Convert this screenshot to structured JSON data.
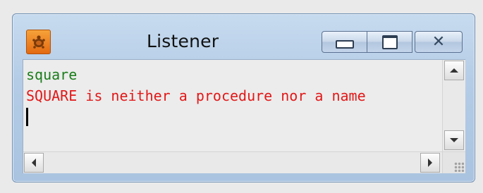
{
  "window": {
    "title": "Listener",
    "icon": "turtle-logo-icon",
    "controls": {
      "minimize": "minimize-icon",
      "maximize": "maximize-icon",
      "close": "close-icon"
    }
  },
  "listener": {
    "lines": [
      {
        "text": "square",
        "kind": "command",
        "color": "#1a7d1a"
      },
      {
        "text": "SQUARE is neither a procedure nor a name",
        "kind": "error",
        "color": "#e21818"
      }
    ]
  },
  "colors": {
    "titlebar": "#b4cce6",
    "command_text": "#1a7d1a",
    "error_text": "#e21818"
  }
}
